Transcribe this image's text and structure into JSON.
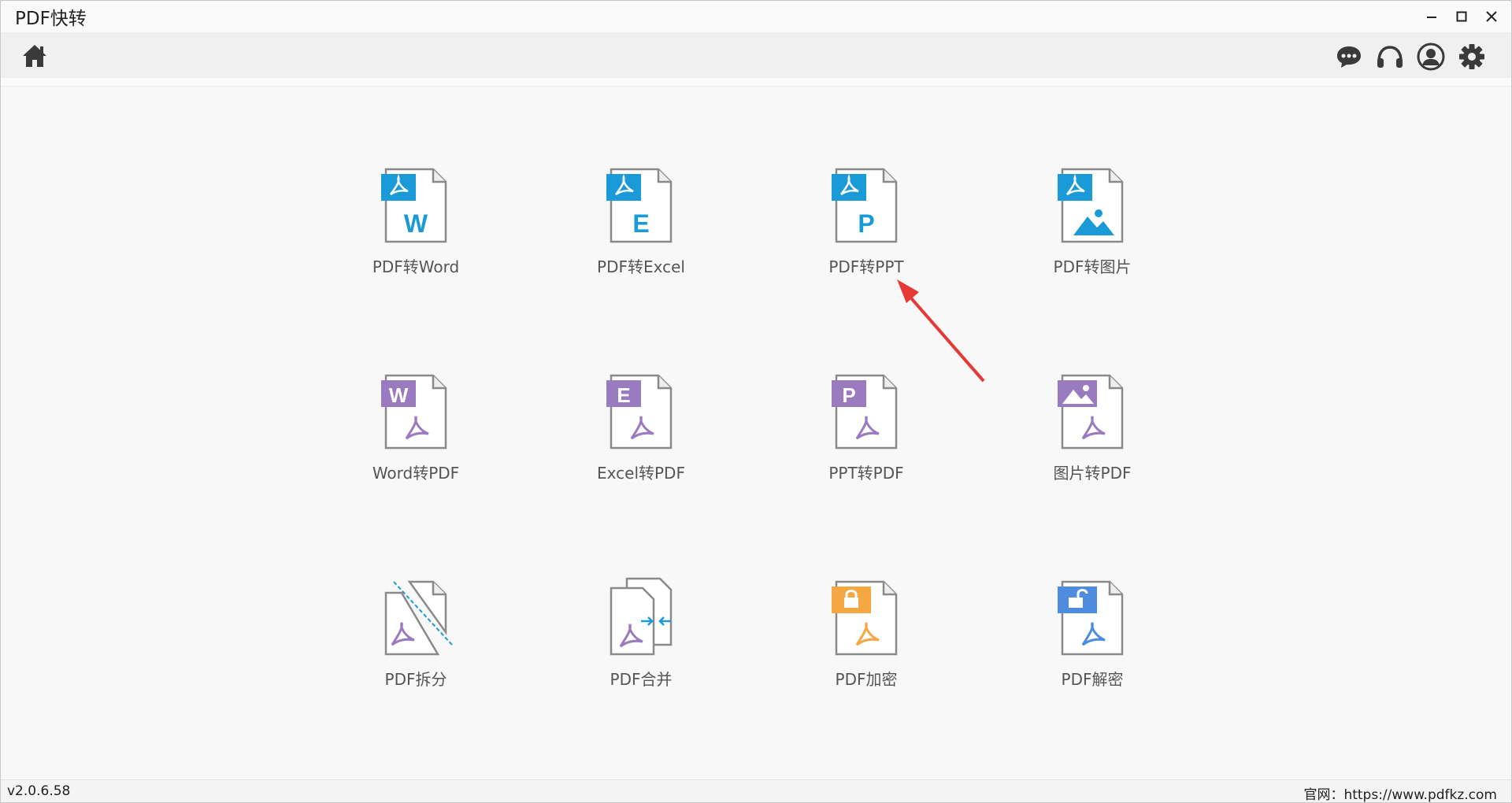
{
  "window": {
    "title": "PDF快转"
  },
  "toolbar": {
    "home_icon": "home-icon",
    "right_icons": [
      "chat-icon",
      "headset-icon",
      "user-icon",
      "gear-icon"
    ]
  },
  "tools": [
    {
      "label": "PDF转Word",
      "badge": "W",
      "kind": "from-pdf"
    },
    {
      "label": "PDF转Excel",
      "badge": "E",
      "kind": "from-pdf"
    },
    {
      "label": "PDF转PPT",
      "badge": "P",
      "kind": "from-pdf"
    },
    {
      "label": "PDF转图片",
      "badge": "image",
      "kind": "from-pdf"
    },
    {
      "label": "Word转PDF",
      "badge": "W",
      "kind": "to-pdf"
    },
    {
      "label": "Excel转PDF",
      "badge": "E",
      "kind": "to-pdf"
    },
    {
      "label": "PPT转PDF",
      "badge": "P",
      "kind": "to-pdf"
    },
    {
      "label": "图片转PDF",
      "badge": "image",
      "kind": "to-pdf"
    },
    {
      "label": "PDF拆分",
      "badge": "split",
      "kind": "split"
    },
    {
      "label": "PDF合并",
      "badge": "merge",
      "kind": "merge"
    },
    {
      "label": "PDF加密",
      "badge": "lock",
      "kind": "encrypt"
    },
    {
      "label": "PDF解密",
      "badge": "unlock",
      "kind": "decrypt"
    }
  ],
  "colors": {
    "from_pdf_badge": "#1a9ad6",
    "to_pdf_badge": "#9b7bbf",
    "encrypt_badge": "#f5a742",
    "decrypt_badge": "#4e8ce0",
    "annotation_arrow": "#e53935"
  },
  "statusbar": {
    "version": "v2.0.6.58",
    "website": "官网：https://www.pdfkz.com"
  }
}
